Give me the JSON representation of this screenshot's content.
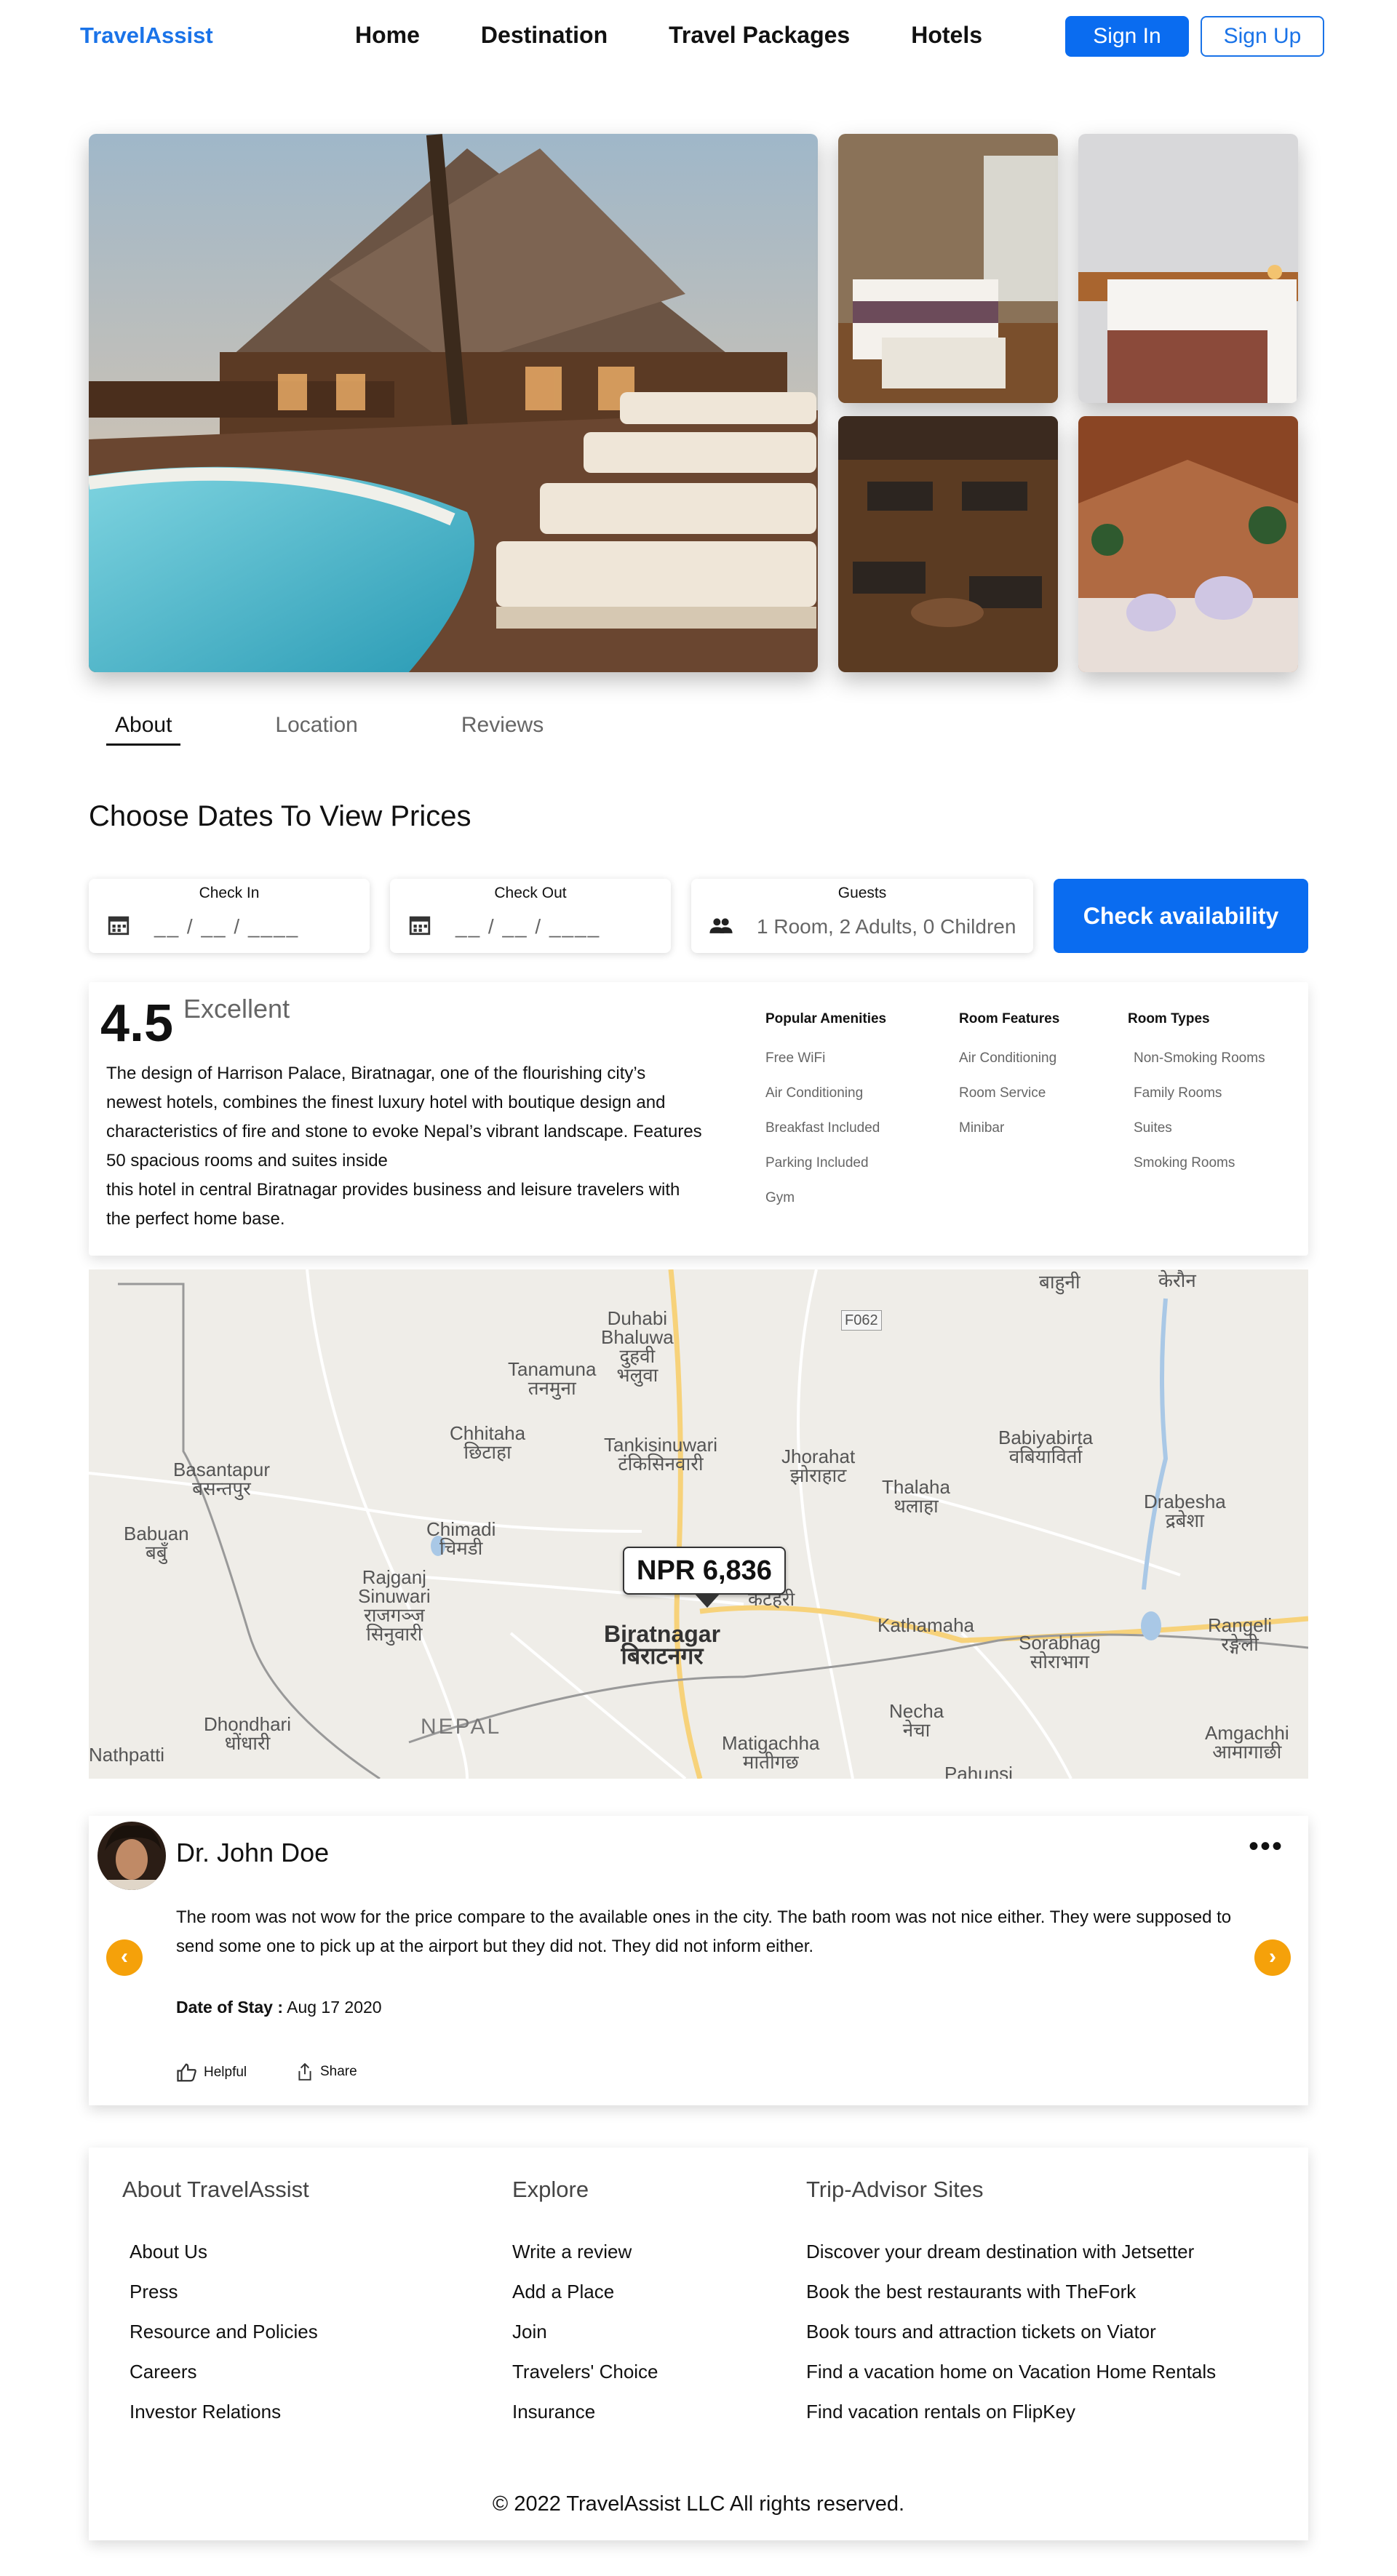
{
  "nav": {
    "brand": "TravelAssist",
    "links": [
      "Home",
      "Destination",
      "Travel Packages",
      "Hotels"
    ],
    "sign_in": "Sign In",
    "sign_up": "Sign Up"
  },
  "tabs": [
    "About",
    "Location",
    "Reviews"
  ],
  "section_title": "Choose Dates To View Prices",
  "booking": {
    "check_in_label": "Check In",
    "check_in_value": "__ / __ / ____",
    "check_out_label": "Check Out",
    "check_out_value": "__ / __ / ____",
    "guests_label": "Guests",
    "guests_value": "1 Room, 2 Adults, 0 Children",
    "button": "Check availability"
  },
  "hotel": {
    "rating": "4.5",
    "rating_word": "Excellent",
    "description_1": "The design of Harrison Palace, Biratnagar, one of the flourishing city’s newest hotels, combines the finest luxury hotel with boutique design and characteristics of fire and stone to evoke Nepal’s vibrant landscape. Features 50 spacious rooms and suites inside",
    "description_2": "this hotel in central Biratnagar provides business and leisure travelers with the perfect home base.",
    "popular_amenities": {
      "title": "Popular Amenities",
      "items": [
        "Free WiFi",
        "Air Conditioning",
        "Breakfast Included",
        "Parking Included",
        "Gym"
      ]
    },
    "room_features": {
      "title": "Room Features",
      "items": [
        "Air Conditioning",
        "Room Service",
        "Minibar"
      ]
    },
    "room_types": {
      "title": "Room Types",
      "items": [
        "Non-Smoking Rooms",
        "Family Rooms",
        "Suites",
        "Smoking Rooms"
      ]
    }
  },
  "map": {
    "price": "NPR 6,836",
    "labels": {
      "duhabi": "Duhabi\nBhaluwa\nदुहवी\nभलुवा",
      "tanamuna": "Tanamuna\nतनमुना",
      "chhitaha": "Chhitaha\nछिटाहा",
      "tankisinuwari": "Tankisinuwari\nटंकिसिनवारी",
      "jhorahat": "Jhorahat\nझोराहाट",
      "thalaha": "Thalaha\nथलाहा",
      "babiyabirta": "Babiyabirta\nवबियाविर्ता",
      "basantapur": "Basantapur\nबसन्तपुर",
      "babuan": "Babuan\nबबुँ",
      "chimadi": "Chimadi\nचिमडी",
      "drabesha": "Drabesha\nद्रबेशा",
      "rajganj": "Rajganj\nSinuwari\nराजगञ्ज\nसिनुवारी",
      "biratnagar": "Biratnagar\nबिराटनगर",
      "kathamaha": "Kathamaha",
      "sorabhag": "Sorabhag\nसोराभाग",
      "rangeli": "Rangeli\nरङ्गेली",
      "dhondhari": "Dhondhari\nधोंधारी",
      "nepal": "NEPAL",
      "matigachha": "Matigachha\nमातीगछ",
      "necha": "Necha\nनेचा",
      "amgachhi": "Amgachhi\nआमागाछी",
      "nathpatti": "Nathpatti",
      "pahunsi": "Pahunsi",
      "bahuni": "बाहुनी",
      "keraun": "केरौन",
      "road": "F062",
      "katahari": "कटहरी"
    }
  },
  "review": {
    "name": "Dr. John Doe",
    "more": "•••",
    "text": "The room was not wow for the price compare to the available ones in the city. The bath room was not nice either. They were supposed to send some one to pick up at the airport but they did not. They did not inform either.",
    "stay_label": "Date of Stay :",
    "stay_date": "Aug 17 2020",
    "helpful": "Helpful",
    "share": "Share"
  },
  "footer": {
    "about": {
      "title": "About TravelAssist",
      "items": [
        "About Us",
        "Press",
        "Resource and Policies",
        "Careers",
        "Investor Relations"
      ]
    },
    "explore": {
      "title": "Explore",
      "items": [
        "Write a review",
        "Add a Place",
        "Join",
        "Travelers' Choice",
        "Insurance"
      ]
    },
    "trip": {
      "title": "Trip-Advisor Sites",
      "items": [
        "Discover your dream destination with Jetsetter",
        "Book the best restaurants with TheFork",
        "Book tours and attraction tickets on Viator",
        "Find a vacation home on Vacation Home Rentals",
        "Find vacation rentals on FlipKey"
      ]
    },
    "copyright": "© 2022 TravelAssist LLC All rights reserved."
  },
  "colors": {
    "primary": "#0a6cf0",
    "accent": "#f5a10a",
    "map_bg": "#efede8",
    "road": "#f7d27a"
  }
}
